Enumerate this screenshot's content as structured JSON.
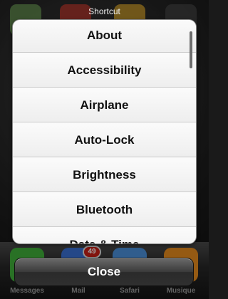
{
  "header": {
    "title": "Shortcut"
  },
  "shortcut_list": {
    "items": [
      {
        "label": "About"
      },
      {
        "label": "Accessibility"
      },
      {
        "label": "Airplane"
      },
      {
        "label": "Auto-Lock"
      },
      {
        "label": "Brightness"
      },
      {
        "label": "Bluetooth"
      },
      {
        "label": "Date & Time"
      }
    ]
  },
  "footer": {
    "close_label": "Close"
  },
  "dock": {
    "badge": "49",
    "apps": [
      {
        "label": "Messages",
        "color": "#3fae3a"
      },
      {
        "label": "Mail",
        "color": "#3a6fd1"
      },
      {
        "label": "Safari",
        "color": "#4a90d9"
      },
      {
        "label": "Musique",
        "color": "#e58a1e"
      }
    ]
  },
  "colors": {
    "panel": "#f7f7f7",
    "close_button": "#333333",
    "badge": "#c61f16"
  }
}
